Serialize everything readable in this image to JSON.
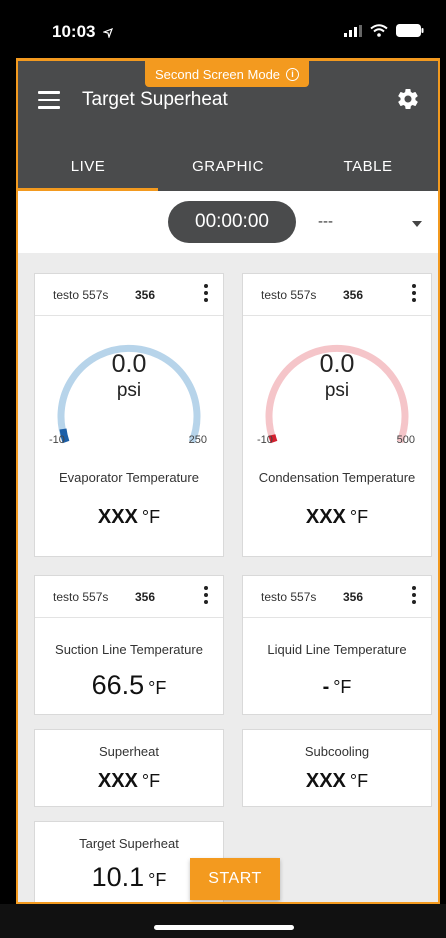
{
  "status_bar": {
    "time": "10:03"
  },
  "app": {
    "second_screen_badge": "Second Screen Mode",
    "title": "Target Superheat",
    "tabs": [
      {
        "label": "LIVE",
        "active": true
      },
      {
        "label": "GRAPHIC",
        "active": false
      },
      {
        "label": "TABLE",
        "active": false
      }
    ],
    "timer": "00:00:00",
    "timer_select": "---"
  },
  "cards": {
    "evaporator": {
      "device": "testo 557s",
      "serial": "356",
      "gauge_value": "0.0",
      "gauge_unit": "psi",
      "gauge_min": "-10",
      "gauge_max": "250",
      "gauge_color": "#b7d4ea",
      "gauge_accent": "#1c5fa8",
      "label": "Evaporator Temperature",
      "value": "XXX",
      "unit": "°F"
    },
    "condensation": {
      "device": "testo 557s",
      "serial": "356",
      "gauge_value": "0.0",
      "gauge_unit": "psi",
      "gauge_min": "-10",
      "gauge_max": "500",
      "gauge_color": "#f5c5c9",
      "gauge_accent": "#d3202f",
      "label": "Condensation Temperature",
      "value": "XXX",
      "unit": "°F"
    },
    "suction": {
      "device": "testo 557s",
      "serial": "356",
      "label": "Suction Line Temperature",
      "value": "66.5",
      "unit": "°F"
    },
    "liquid": {
      "device": "testo 557s",
      "serial": "356",
      "label": "Liquid Line Temperature",
      "value": "-",
      "unit": "°F"
    },
    "superheat": {
      "label": "Superheat",
      "value": "XXX",
      "unit": "°F"
    },
    "subcooling": {
      "label": "Subcooling",
      "value": "XXX",
      "unit": "°F"
    },
    "target_superheat": {
      "label": "Target Superheat",
      "value": "10.1",
      "unit": "°F"
    }
  },
  "start_button": "START",
  "colors": {
    "accent": "#f39a1f",
    "appbar": "#4a4b4c"
  }
}
